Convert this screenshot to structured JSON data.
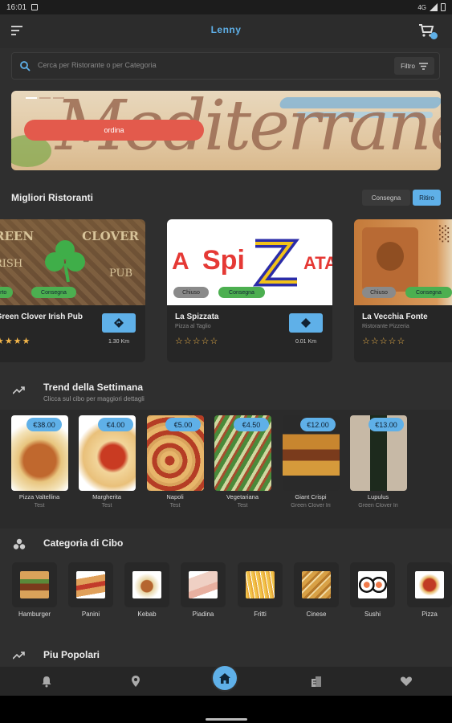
{
  "status_bar": {
    "time": "16:01",
    "signal": "4G"
  },
  "appbar": {
    "title": "Lenny"
  },
  "search": {
    "placeholder": "Cerca per Ristorante o per Categoria",
    "filter_label": "Filtro"
  },
  "banner": {
    "order_label": "ordina"
  },
  "restaurants_section": {
    "title": "Migliori Ristoranti",
    "chips": [
      {
        "label": "Consegna",
        "active": false
      },
      {
        "label": "Ritiro",
        "active": true
      }
    ],
    "cards": [
      {
        "name": "Green Clover Irish Pub",
        "subtitle": "",
        "distance": "1.30 Km",
        "stars": "★★★★",
        "badges": [
          "Aperto",
          "Consegna"
        ]
      },
      {
        "name": "La Spizzata",
        "subtitle": "Pizza al Taglio",
        "distance": "0.01 Km",
        "stars": "☆☆☆☆☆",
        "badges": [
          "Chiuso",
          "Consegna"
        ]
      },
      {
        "name": "La Vecchia Fonte",
        "subtitle": "Ristorante Pizzeria",
        "distance": "",
        "stars": "☆☆☆☆☆",
        "badges": [
          "Chiuso",
          "Consegna"
        ]
      }
    ]
  },
  "trend_section": {
    "title": "Trend della Settimana",
    "subtitle": "Clicca sul cibo per maggiori dettagli",
    "items": [
      {
        "name": "Pizza Valtellina",
        "place": "Test",
        "price": "€38.00"
      },
      {
        "name": "Margherita",
        "place": "Test",
        "price": "€4.00"
      },
      {
        "name": "Napoli",
        "place": "Test",
        "price": "€5.00"
      },
      {
        "name": "Vegetariana",
        "place": "Test",
        "price": "€4.50"
      },
      {
        "name": "Giant Crispi",
        "place": "Green Clover Iri",
        "price": "€12.00"
      },
      {
        "name": "Lupulus",
        "place": "Green Clover Iri",
        "price": "€13.00"
      }
    ]
  },
  "category_section": {
    "title": "Categoria di Cibo",
    "items": [
      {
        "label": "Hamburger"
      },
      {
        "label": "Panini"
      },
      {
        "label": "Kebab"
      },
      {
        "label": "Piadina"
      },
      {
        "label": "Fritti"
      },
      {
        "label": "Cinese"
      },
      {
        "label": "Sushi"
      },
      {
        "label": "Pizza"
      }
    ]
  },
  "popular_section": {
    "title": "Piu Popolari"
  },
  "colors": {
    "accent": "#5fb0e8",
    "order_button": "#e35a4c",
    "delivery_badge": "#4caf50"
  }
}
